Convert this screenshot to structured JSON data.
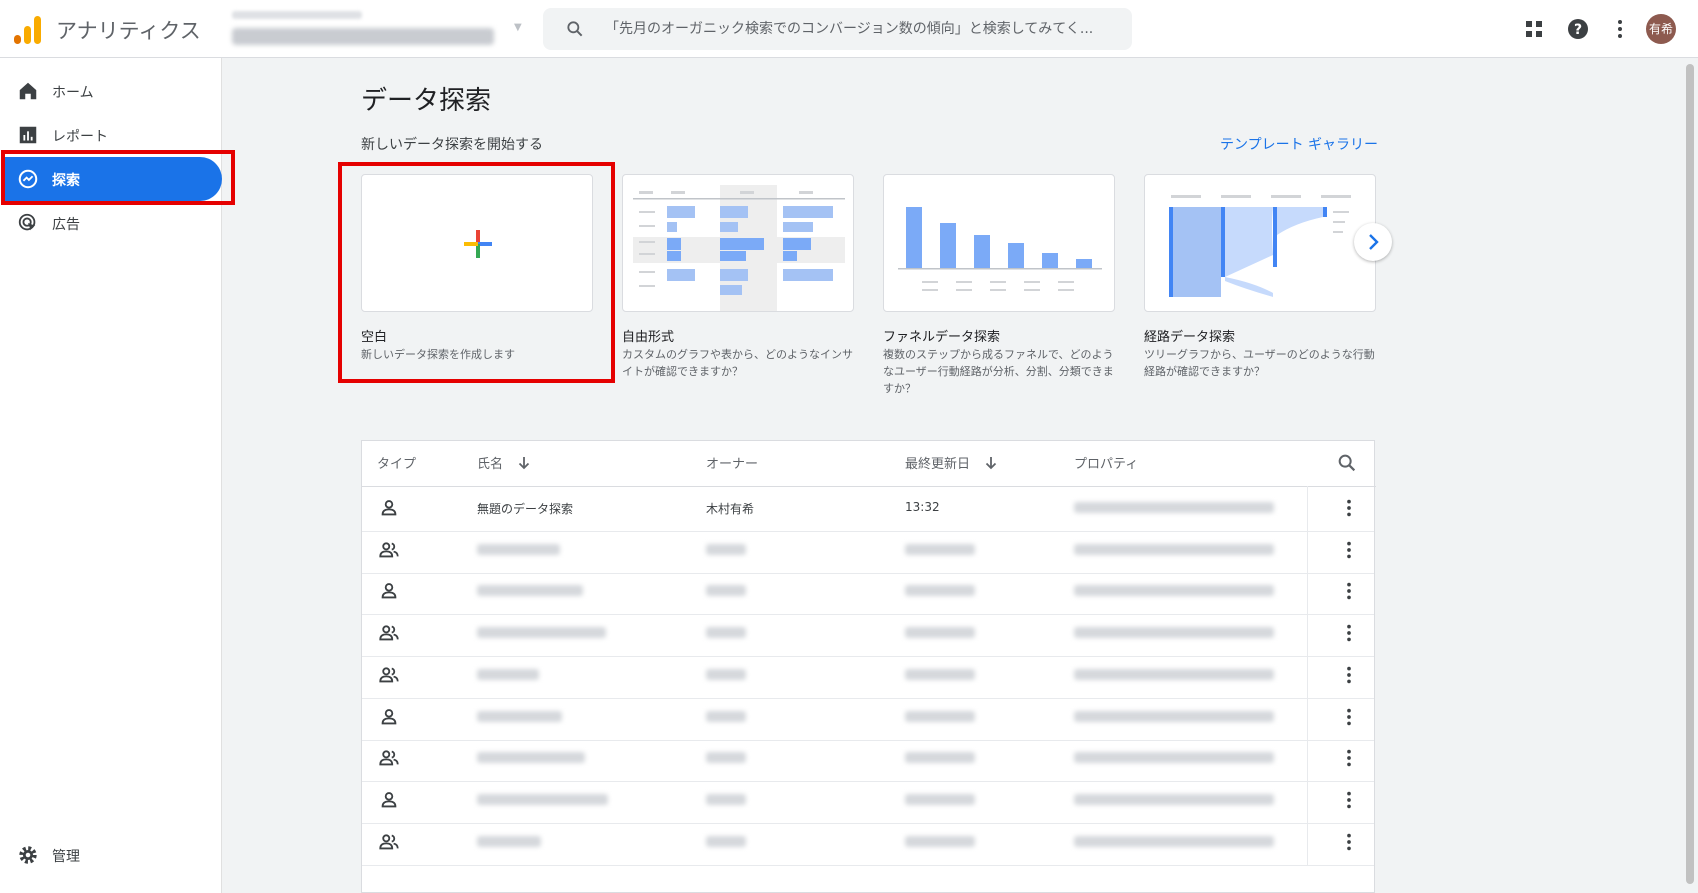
{
  "app": {
    "title": "アナリティクス",
    "avatar_text": "有希"
  },
  "search": {
    "placeholder": "「先月のオーガニック検索でのコンバージョン数の傾向」と検索してみてく..."
  },
  "sidebar": {
    "items": [
      {
        "label": "ホーム",
        "icon": "home-icon"
      },
      {
        "label": "レポート",
        "icon": "bar-chart-icon"
      },
      {
        "label": "探索",
        "icon": "explore-icon",
        "active": true
      },
      {
        "label": "広告",
        "icon": "ads-icon"
      }
    ],
    "admin_label": "管理"
  },
  "main": {
    "title": "データ探索",
    "section_title": "新しいデータ探索を開始する",
    "gallery_link": "テンプレート ギャラリー",
    "cards": [
      {
        "title": "空白",
        "desc": "新しいデータ探索を作成します"
      },
      {
        "title": "自由形式",
        "desc": "カスタムのグラフや表から、どのようなインサイトが確認できますか？"
      },
      {
        "title": "ファネルデータ探索",
        "desc": "複数のステップから成るファネルで、どのようなユーザー行動経路が分析、分割、分類できますか？"
      },
      {
        "title": "経路データ探索",
        "desc": "ツリーグラフから、ユーザーのどのような行動経路が確認できますか？"
      }
    ]
  },
  "table": {
    "headers": {
      "type": "タイプ",
      "name": "氏名",
      "owner": "オーナー",
      "updated": "最終更新日",
      "property": "プロパティ"
    },
    "rows": [
      {
        "type": "person",
        "name": "無題のデータ探索",
        "owner": "木村有希",
        "updated": "13:32",
        "property": "",
        "blurred": false
      },
      {
        "type": "group",
        "name": "",
        "owner": "",
        "updated": "",
        "property": "",
        "blurred": true
      },
      {
        "type": "person",
        "name": "",
        "owner": "",
        "updated": "",
        "property": "",
        "blurred": true
      },
      {
        "type": "group",
        "name": "",
        "owner": "",
        "updated": "",
        "property": "",
        "blurred": true
      },
      {
        "type": "group",
        "name": "",
        "owner": "",
        "updated": "",
        "property": "",
        "blurred": true
      },
      {
        "type": "person",
        "name": "",
        "owner": "",
        "updated": "",
        "property": "",
        "blurred": true
      },
      {
        "type": "group",
        "name": "",
        "owner": "",
        "updated": "",
        "property": "",
        "blurred": true
      },
      {
        "type": "person",
        "name": "",
        "owner": "",
        "updated": "",
        "property": "",
        "blurred": true
      },
      {
        "type": "group",
        "name": "",
        "owner": "",
        "updated": "",
        "property": "",
        "blurred": true
      }
    ]
  },
  "colors": {
    "accent": "#1a73e8",
    "highlight": "#e50000",
    "logo_orange": "#f9ab00",
    "logo_dark": "#e37400"
  }
}
